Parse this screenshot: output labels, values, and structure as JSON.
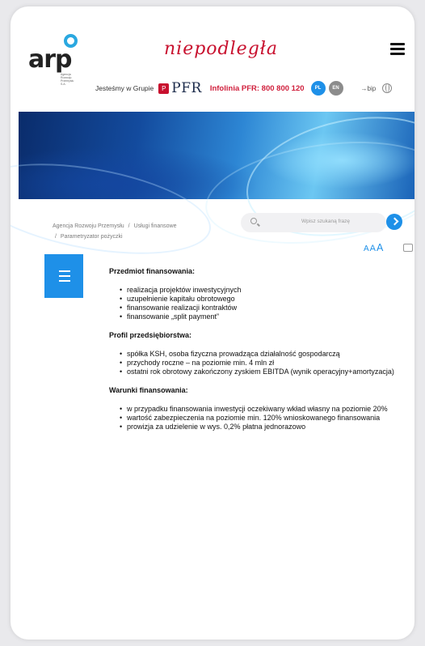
{
  "header": {
    "logo_text": "arp",
    "logo_sub": "Agencja Rozwoju Przemysłu S.A.",
    "niepodlegla": "niepodległa",
    "jestesmy": "Jesteśmy w Grupie",
    "pfr_mark": "P",
    "pfr_text": "PFR",
    "infolinia": "Infolinia PFR: 800 800 120",
    "lang_pl": "PL",
    "lang_en": "EN",
    "bip": "bip"
  },
  "breadcrumb": {
    "item1": "Agencja Rozwoju Przemysłu",
    "item2": "Usługi finansowe",
    "item3": "Parametryzator pożyczki",
    "sep": "/"
  },
  "search": {
    "placeholder": "Wpisz szukaną frazę"
  },
  "fontsize": {
    "a1": "A",
    "a2": "A",
    "a3": "A"
  },
  "content": {
    "section1": {
      "title": "Przedmiot finansowania:",
      "items": [
        "realizacja projektów inwestycyjnych",
        "uzupełnienie kapitału obrotowego",
        "finansowanie realizacji kontraktów",
        "finansowanie „split payment”"
      ]
    },
    "section2": {
      "title": "Profil przedsiębiorstwa:",
      "items": [
        "spółka KSH, osoba fizyczna prowadząca działalność gospodarczą",
        "przychody roczne – na poziomie min. 4 mln zł",
        "ostatni rok obrotowy zakończony zyskiem EBITDA (wynik operacyjny+amortyzacja)"
      ]
    },
    "section3": {
      "title": "Warunki finansowania:",
      "items": [
        "w przypadku finansowania inwestycji oczekiwany wkład własny na poziomie 20%",
        "wartość zabezpieczenia na poziomie min. 120% wnioskowanego finansowania",
        "prowizja za udzielenie w wys. 0,2% płatna jednorazowo"
      ]
    }
  }
}
